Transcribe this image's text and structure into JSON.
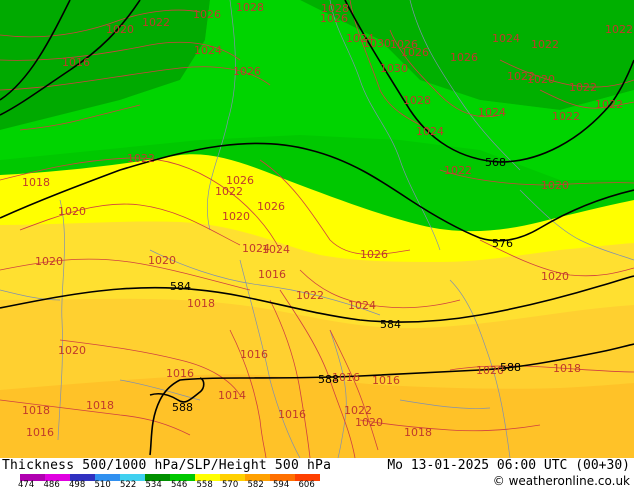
{
  "map": {
    "colors": {
      "band_510": "#00a000",
      "band_516": "#00b400",
      "band_522": "#00c800",
      "band_528": "#00d400",
      "band_534": "#ffff00",
      "band_540": "#ffe020",
      "band_546": "#ffd030",
      "band_552": "#ffc020",
      "slp_isobar": "#d04040",
      "height_contour": "#000000",
      "borders": "#8090b0"
    },
    "slp_labels": [
      "1020",
      "1022",
      "1026",
      "1028",
      "1028",
      "1024",
      "1030",
      "1026",
      "1026",
      "1026",
      "1026",
      "1024",
      "1022",
      "1022",
      "1016",
      "1024",
      "1026",
      "1030",
      "1022",
      "1020",
      "1028",
      "1022",
      "1024",
      "1024",
      "1022",
      "1022",
      "1018",
      "1022",
      "1026",
      "1022",
      "1020",
      "1020",
      "1026",
      "1024",
      "1026",
      "1020",
      "1022",
      "1020",
      "1020",
      "1016",
      "1018",
      "1024",
      "1022",
      "1024",
      "1020",
      "1016",
      "1016",
      "1020",
      "1018",
      "1014",
      "1016",
      "1022",
      "1018",
      "1020",
      "1016",
      "1018",
      "1016",
      "1020",
      "1018",
      "1016"
    ],
    "height_labels": [
      "568",
      "576",
      "584",
      "584",
      "588",
      "588",
      "588"
    ]
  },
  "footer": {
    "title": "Thickness 500/1000 hPa/SLP/Height 500 hPa",
    "datetime": "Mo 13-01-2025 06:00 UTC (00+30)",
    "credit": "© weatheronline.co.uk",
    "legend": [
      {
        "label": "474",
        "color": "#b000b0"
      },
      {
        "label": "486",
        "color": "#e000e0"
      },
      {
        "label": "498",
        "color": "#3030c0"
      },
      {
        "label": "510",
        "color": "#3090f0"
      },
      {
        "label": "522",
        "color": "#40d0f0"
      },
      {
        "label": "534",
        "color": "#009000"
      },
      {
        "label": "546",
        "color": "#00c800"
      },
      {
        "label": "558",
        "color": "#ffff00"
      },
      {
        "label": "570",
        "color": "#ffd000"
      },
      {
        "label": "582",
        "color": "#ffa000"
      },
      {
        "label": "594",
        "color": "#ff7000"
      },
      {
        "label": "606",
        "color": "#ff4000"
      }
    ]
  }
}
